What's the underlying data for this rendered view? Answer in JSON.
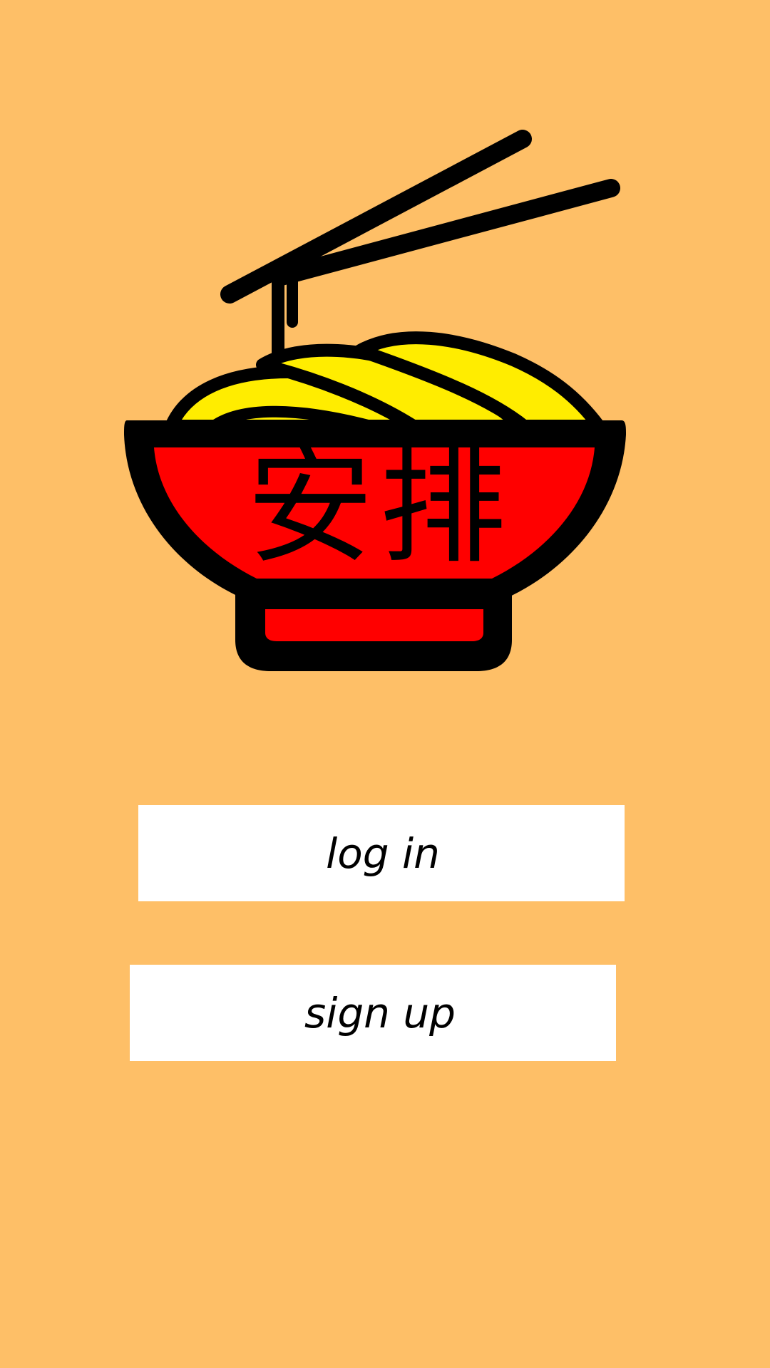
{
  "app": {
    "logo_text": "安排",
    "logo_icon": "noodle-bowl-with-chopsticks-icon"
  },
  "actions": {
    "login_label": "log in",
    "signup_label": "sign up"
  },
  "colors": {
    "background": "#FEBF67",
    "bowl": "#FF0000",
    "noodles": "#FFED00",
    "outline": "#000000",
    "button": "#FFFFFF"
  }
}
